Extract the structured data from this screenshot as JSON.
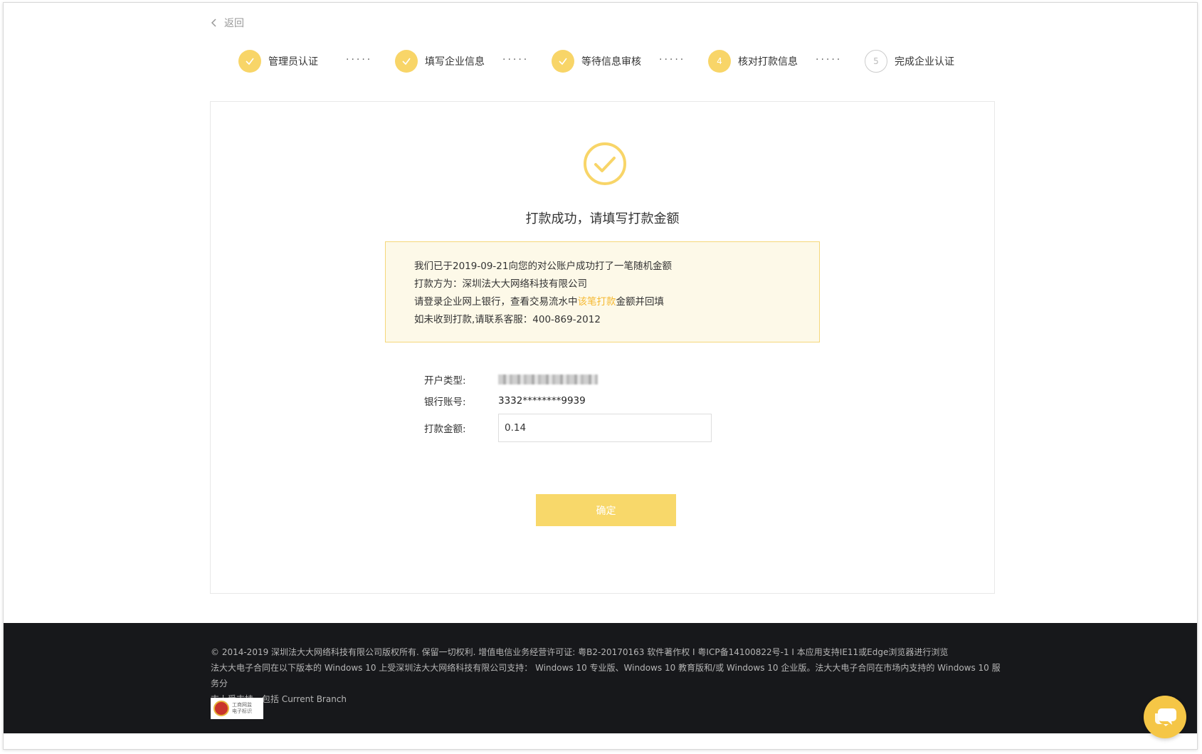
{
  "nav": {
    "back_label": "返回"
  },
  "steps": [
    {
      "label": "管理员认证",
      "status": "done",
      "number": ""
    },
    {
      "label": "填写企业信息",
      "status": "done",
      "number": ""
    },
    {
      "label": "等待信息审核",
      "status": "done",
      "number": ""
    },
    {
      "label": "核对打款信息",
      "status": "active",
      "number": "4"
    },
    {
      "label": "完成企业认证",
      "status": "todo",
      "number": "5"
    }
  ],
  "step_separator": "·····",
  "card": {
    "title": "打款成功，请填写打款金额",
    "notice": {
      "line1": "我们已于2019-09-21向您的对公账户成功打了一笔随机金额",
      "line2": "打款方为：深圳法大大网络科技有限公司",
      "line3_pre": "请登录企业网上银行，查看交易流水中",
      "line3_highlight": "该笔打款",
      "line3_post": "金额并回填",
      "line4": "如未收到打款,请联系客服：400-869-2012"
    },
    "form": {
      "account_type_label": "开户类型:",
      "bank_account_label": "银行账号:",
      "bank_account_value": "3332********9939",
      "amount_label": "打款金额:",
      "amount_value": "0.14"
    },
    "confirm_label": "确定"
  },
  "footer": {
    "line1": "© 2014-2019 深圳法大大网络科技有限公司版权所有. 保留一切权利. 增值电信业务经营许可证:  粤B2-20170163 软件著作权  I  粤ICP备14100822号-1 I  本应用支持IE11或Edge浏览器进行浏览",
    "line2": "法大大电子合同在以下版本的 Windows 10 上受深圳法大大网络科技有限公司支持：  Windows 10 专业版、Windows 10 教育版和/或 Windows 10 企业版。法大大电子合同在市场内支持的 Windows 10 服务分",
    "line3": "支上受支持，包括 Current Branch",
    "badge_line1": "工商网监",
    "badge_line2": "电子标识"
  },
  "colors": {
    "accent": "#f8d568",
    "highlight_text": "#f5b932",
    "notice_bg": "#fdf9e8",
    "footer_bg": "#17181b"
  }
}
